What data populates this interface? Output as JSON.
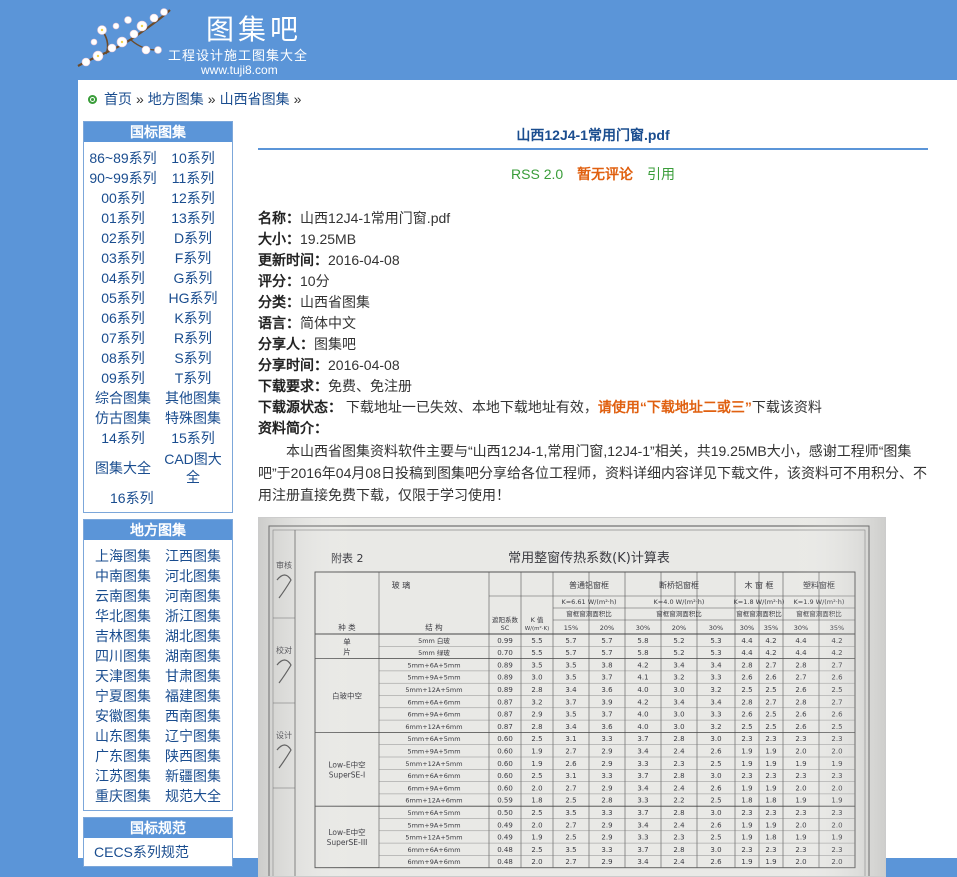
{
  "header": {
    "site_title": "图集吧",
    "slogan": "工程设计施工图集大全",
    "url": "www.tuji8.com"
  },
  "breadcrumb": [
    "首页",
    "地方图集",
    "山西省图集"
  ],
  "sidebar": {
    "guobiao": {
      "title": "国标图集",
      "items": [
        "86~89系列",
        "10系列",
        "90~99系列",
        "11系列",
        "00系列",
        "12系列",
        "01系列",
        "13系列",
        "02系列",
        "D系列",
        "03系列",
        "F系列",
        "04系列",
        "G系列",
        "05系列",
        "HG系列",
        "06系列",
        "K系列",
        "07系列",
        "R系列",
        "08系列",
        "S系列",
        "09系列",
        "T系列",
        "综合图集",
        "其他图集",
        "仿古图集",
        "特殊图集",
        "14系列",
        "15系列",
        "图集大全",
        "CAD图大全",
        "16系列"
      ]
    },
    "difang": {
      "title": "地方图集",
      "items": [
        "上海图集",
        "江西图集",
        "中南图集",
        "河北图集",
        "云南图集",
        "河南图集",
        "华北图集",
        "浙江图集",
        "吉林图集",
        "湖北图集",
        "四川图集",
        "湖南图集",
        "天津图集",
        "甘肃图集",
        "宁夏图集",
        "福建图集",
        "安徽图集",
        "西南图集",
        "山东图集",
        "辽宁图集",
        "广东图集",
        "陕西图集",
        "江苏图集",
        "新疆图集",
        "重庆图集",
        "规范大全"
      ]
    },
    "guifan": {
      "title": "国标规范",
      "items": [
        "CECS系列规范"
      ]
    }
  },
  "doc": {
    "title": "山西12J4-1常用门窗.pdf",
    "rss": "RSS 2.0",
    "comments": "暂无评论",
    "cite": "引用",
    "labels": {
      "name": "名称：",
      "size": "大小：",
      "updated": "更新时间：",
      "rating": "评分：",
      "category": "分类：",
      "language": "语言：",
      "sharer": "分享人：",
      "share_time": "分享时间：",
      "requirement": "下载要求：",
      "source_status": "下载源状态：",
      "intro": "资料简介："
    },
    "name": "山西12J4-1常用门窗.pdf",
    "size": "19.25MB",
    "updated": "2016-04-08",
    "rating": "10分",
    "category": "山西省图集",
    "language": "简体中文",
    "sharer": "图集吧",
    "share_time": "2016-04-08",
    "requirement": "免费、免注册",
    "source_status_pre": " 下载地址一已失效、本地下载地址有效，",
    "source_status_hl": "请使用“下载地址二或三”",
    "source_status_post": "下载该资料",
    "intro": "本山西省图集资料软件主要与“山西12J4-1,常用门窗,12J4-1”相关，共19.25MB大小，感谢工程师“图集吧”于2016年04月08日投稿到图集吧分享给各位工程师，资料详细内容详见下载文件，该资料可不用积分、不用注册直接免费下载，仅限于学习使用！"
  },
  "preview": {
    "table_title": "常用整窗传热系数(K)计算表",
    "appendix": "附表 2",
    "headers": [
      "玻 璃",
      "普通铝窗框",
      "断桥铝窗框",
      "木 窗 框",
      "塑料窗框"
    ],
    "k_values": [
      "K=6.61 W/(m²·h)",
      "K=4.0 W/(m²·h)",
      "K=1.8 W/(m²·h)",
      "K=1.9 W/(m²·h)"
    ],
    "sub_header": "窗框窗洞面积比",
    "col_labels": [
      "种 类",
      "结 构",
      "遮阳系数 SC",
      "K 值 W/(m²·K)",
      "15%",
      "20%",
      "30%",
      "20%",
      "30%",
      "30%",
      "35%",
      "30%",
      "35%"
    ],
    "groups": [
      "单 片",
      "白玻中空",
      "Low-E中空 SuperSE-I",
      "Low-E中空 SuperSE-III"
    ],
    "structures": [
      "5mm 白玻",
      "5mm 绿玻",
      "5mm+6A+5mm",
      "5mm+9A+5mm",
      "5mm+12A+5mm",
      "6mm+6A+6mm",
      "6mm+9A+6mm",
      "6mm+12A+6mm",
      "5mm+6A+5mm",
      "5mm+9A+5mm",
      "5mm+12A+5mm",
      "6mm+6A+6mm",
      "6mm+9A+6mm",
      "6mm+12A+6mm",
      "5mm+6A+5mm",
      "5mm+9A+5mm",
      "5mm+12A+5mm",
      "6mm+6A+6mm",
      "6mm+9A+6mm"
    ],
    "sc": [
      "0.99",
      "0.70",
      "0.89",
      "0.89",
      "0.89",
      "0.87",
      "0.87",
      "0.87",
      "0.60",
      "0.60",
      "0.60",
      "0.60",
      "0.60",
      "0.59",
      "0.50",
      "0.49",
      "0.49",
      "0.48",
      "0.48"
    ],
    "kval": [
      "5.5",
      "5.5",
      "3.5",
      "3.0",
      "2.8",
      "3.2",
      "2.9",
      "2.8",
      "2.5",
      "1.9",
      "1.9",
      "2.5",
      "2.0",
      "1.8",
      "2.5",
      "2.0",
      "1.9",
      "2.5",
      "2.0"
    ],
    "c15": [
      "5.7",
      "5.7",
      "3.5",
      "3.5",
      "3.4",
      "3.7",
      "3.5",
      "3.4",
      "3.1",
      "2.7",
      "2.6",
      "3.1",
      "2.7",
      "2.5",
      "3.5",
      "2.7",
      "2.5",
      "3.5",
      "2.7"
    ],
    "c20": [
      "5.7",
      "5.7",
      "3.8",
      "3.7",
      "3.6",
      "3.9",
      "3.7",
      "3.6",
      "3.3",
      "2.9",
      "2.9",
      "3.3",
      "2.9",
      "2.8",
      "3.3",
      "2.9",
      "2.9",
      "3.3",
      "2.9"
    ],
    "c30": [
      "5.8",
      "5.8",
      "4.2",
      "4.1",
      "4.0",
      "4.2",
      "4.0",
      "4.0",
      "3.7",
      "3.4",
      "3.3",
      "3.7",
      "3.4",
      "3.3",
      "3.7",
      "3.4",
      "3.3",
      "3.7",
      "3.4"
    ],
    "d20": [
      "5.2",
      "5.2",
      "3.4",
      "3.2",
      "3.0",
      "3.4",
      "3.0",
      "3.0",
      "2.8",
      "2.4",
      "2.3",
      "2.8",
      "2.4",
      "2.2",
      "2.8",
      "2.4",
      "2.3",
      "2.8",
      "2.4"
    ],
    "d30": [
      "5.3",
      "5.3",
      "3.4",
      "3.3",
      "3.2",
      "3.4",
      "3.3",
      "3.2",
      "3.0",
      "2.6",
      "2.5",
      "3.0",
      "2.6",
      "2.5",
      "3.0",
      "2.6",
      "2.5",
      "3.0",
      "2.6"
    ],
    "w30": [
      "4.4",
      "4.4",
      "2.8",
      "2.6",
      "2.5",
      "2.8",
      "2.6",
      "2.5",
      "2.3",
      "1.9",
      "1.9",
      "2.3",
      "1.9",
      "1.8",
      "2.3",
      "1.9",
      "1.9",
      "2.3",
      "1.9"
    ],
    "w35": [
      "4.2",
      "4.2",
      "2.7",
      "2.6",
      "2.5",
      "2.7",
      "2.5",
      "2.5",
      "2.3",
      "1.9",
      "1.9",
      "2.3",
      "1.9",
      "1.8",
      "2.3",
      "1.9",
      "1.8",
      "2.3",
      "1.9"
    ],
    "p30": [
      "4.4",
      "4.4",
      "2.8",
      "2.7",
      "2.6",
      "2.8",
      "2.6",
      "2.6",
      "2.3",
      "2.0",
      "1.9",
      "2.3",
      "2.0",
      "1.9",
      "2.3",
      "2.0",
      "1.9",
      "2.3",
      "2.0"
    ],
    "p35": [
      "4.2",
      "4.2",
      "2.7",
      "2.6",
      "2.5",
      "2.7",
      "2.6",
      "2.5",
      "2.3",
      "2.0",
      "1.9",
      "2.3",
      "2.0",
      "1.9",
      "2.3",
      "2.0",
      "1.9",
      "2.3",
      "2.0"
    ],
    "stamp_labels": [
      "审核",
      "校对",
      "设计"
    ]
  }
}
